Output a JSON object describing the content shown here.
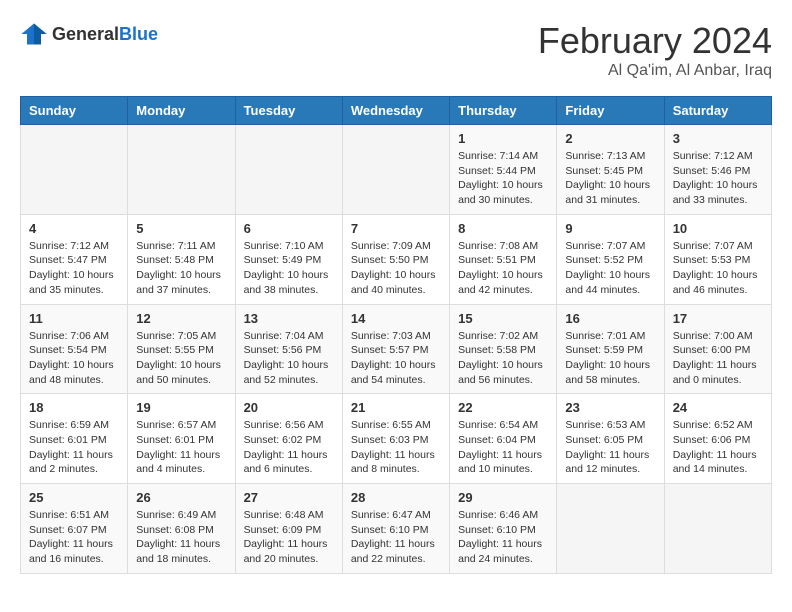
{
  "header": {
    "logo_general": "General",
    "logo_blue": "Blue",
    "month_title": "February 2024",
    "location": "Al Qa'im, Al Anbar, Iraq"
  },
  "weekdays": [
    "Sunday",
    "Monday",
    "Tuesday",
    "Wednesday",
    "Thursday",
    "Friday",
    "Saturday"
  ],
  "weeks": [
    [
      {
        "day": "",
        "info": ""
      },
      {
        "day": "",
        "info": ""
      },
      {
        "day": "",
        "info": ""
      },
      {
        "day": "",
        "info": ""
      },
      {
        "day": "1",
        "info": "Sunrise: 7:14 AM\nSunset: 5:44 PM\nDaylight: 10 hours\nand 30 minutes."
      },
      {
        "day": "2",
        "info": "Sunrise: 7:13 AM\nSunset: 5:45 PM\nDaylight: 10 hours\nand 31 minutes."
      },
      {
        "day": "3",
        "info": "Sunrise: 7:12 AM\nSunset: 5:46 PM\nDaylight: 10 hours\nand 33 minutes."
      }
    ],
    [
      {
        "day": "4",
        "info": "Sunrise: 7:12 AM\nSunset: 5:47 PM\nDaylight: 10 hours\nand 35 minutes."
      },
      {
        "day": "5",
        "info": "Sunrise: 7:11 AM\nSunset: 5:48 PM\nDaylight: 10 hours\nand 37 minutes."
      },
      {
        "day": "6",
        "info": "Sunrise: 7:10 AM\nSunset: 5:49 PM\nDaylight: 10 hours\nand 38 minutes."
      },
      {
        "day": "7",
        "info": "Sunrise: 7:09 AM\nSunset: 5:50 PM\nDaylight: 10 hours\nand 40 minutes."
      },
      {
        "day": "8",
        "info": "Sunrise: 7:08 AM\nSunset: 5:51 PM\nDaylight: 10 hours\nand 42 minutes."
      },
      {
        "day": "9",
        "info": "Sunrise: 7:07 AM\nSunset: 5:52 PM\nDaylight: 10 hours\nand 44 minutes."
      },
      {
        "day": "10",
        "info": "Sunrise: 7:07 AM\nSunset: 5:53 PM\nDaylight: 10 hours\nand 46 minutes."
      }
    ],
    [
      {
        "day": "11",
        "info": "Sunrise: 7:06 AM\nSunset: 5:54 PM\nDaylight: 10 hours\nand 48 minutes."
      },
      {
        "day": "12",
        "info": "Sunrise: 7:05 AM\nSunset: 5:55 PM\nDaylight: 10 hours\nand 50 minutes."
      },
      {
        "day": "13",
        "info": "Sunrise: 7:04 AM\nSunset: 5:56 PM\nDaylight: 10 hours\nand 52 minutes."
      },
      {
        "day": "14",
        "info": "Sunrise: 7:03 AM\nSunset: 5:57 PM\nDaylight: 10 hours\nand 54 minutes."
      },
      {
        "day": "15",
        "info": "Sunrise: 7:02 AM\nSunset: 5:58 PM\nDaylight: 10 hours\nand 56 minutes."
      },
      {
        "day": "16",
        "info": "Sunrise: 7:01 AM\nSunset: 5:59 PM\nDaylight: 10 hours\nand 58 minutes."
      },
      {
        "day": "17",
        "info": "Sunrise: 7:00 AM\nSunset: 6:00 PM\nDaylight: 11 hours\nand 0 minutes."
      }
    ],
    [
      {
        "day": "18",
        "info": "Sunrise: 6:59 AM\nSunset: 6:01 PM\nDaylight: 11 hours\nand 2 minutes."
      },
      {
        "day": "19",
        "info": "Sunrise: 6:57 AM\nSunset: 6:01 PM\nDaylight: 11 hours\nand 4 minutes."
      },
      {
        "day": "20",
        "info": "Sunrise: 6:56 AM\nSunset: 6:02 PM\nDaylight: 11 hours\nand 6 minutes."
      },
      {
        "day": "21",
        "info": "Sunrise: 6:55 AM\nSunset: 6:03 PM\nDaylight: 11 hours\nand 8 minutes."
      },
      {
        "day": "22",
        "info": "Sunrise: 6:54 AM\nSunset: 6:04 PM\nDaylight: 11 hours\nand 10 minutes."
      },
      {
        "day": "23",
        "info": "Sunrise: 6:53 AM\nSunset: 6:05 PM\nDaylight: 11 hours\nand 12 minutes."
      },
      {
        "day": "24",
        "info": "Sunrise: 6:52 AM\nSunset: 6:06 PM\nDaylight: 11 hours\nand 14 minutes."
      }
    ],
    [
      {
        "day": "25",
        "info": "Sunrise: 6:51 AM\nSunset: 6:07 PM\nDaylight: 11 hours\nand 16 minutes."
      },
      {
        "day": "26",
        "info": "Sunrise: 6:49 AM\nSunset: 6:08 PM\nDaylight: 11 hours\nand 18 minutes."
      },
      {
        "day": "27",
        "info": "Sunrise: 6:48 AM\nSunset: 6:09 PM\nDaylight: 11 hours\nand 20 minutes."
      },
      {
        "day": "28",
        "info": "Sunrise: 6:47 AM\nSunset: 6:10 PM\nDaylight: 11 hours\nand 22 minutes."
      },
      {
        "day": "29",
        "info": "Sunrise: 6:46 AM\nSunset: 6:10 PM\nDaylight: 11 hours\nand 24 minutes."
      },
      {
        "day": "",
        "info": ""
      },
      {
        "day": "",
        "info": ""
      }
    ]
  ]
}
